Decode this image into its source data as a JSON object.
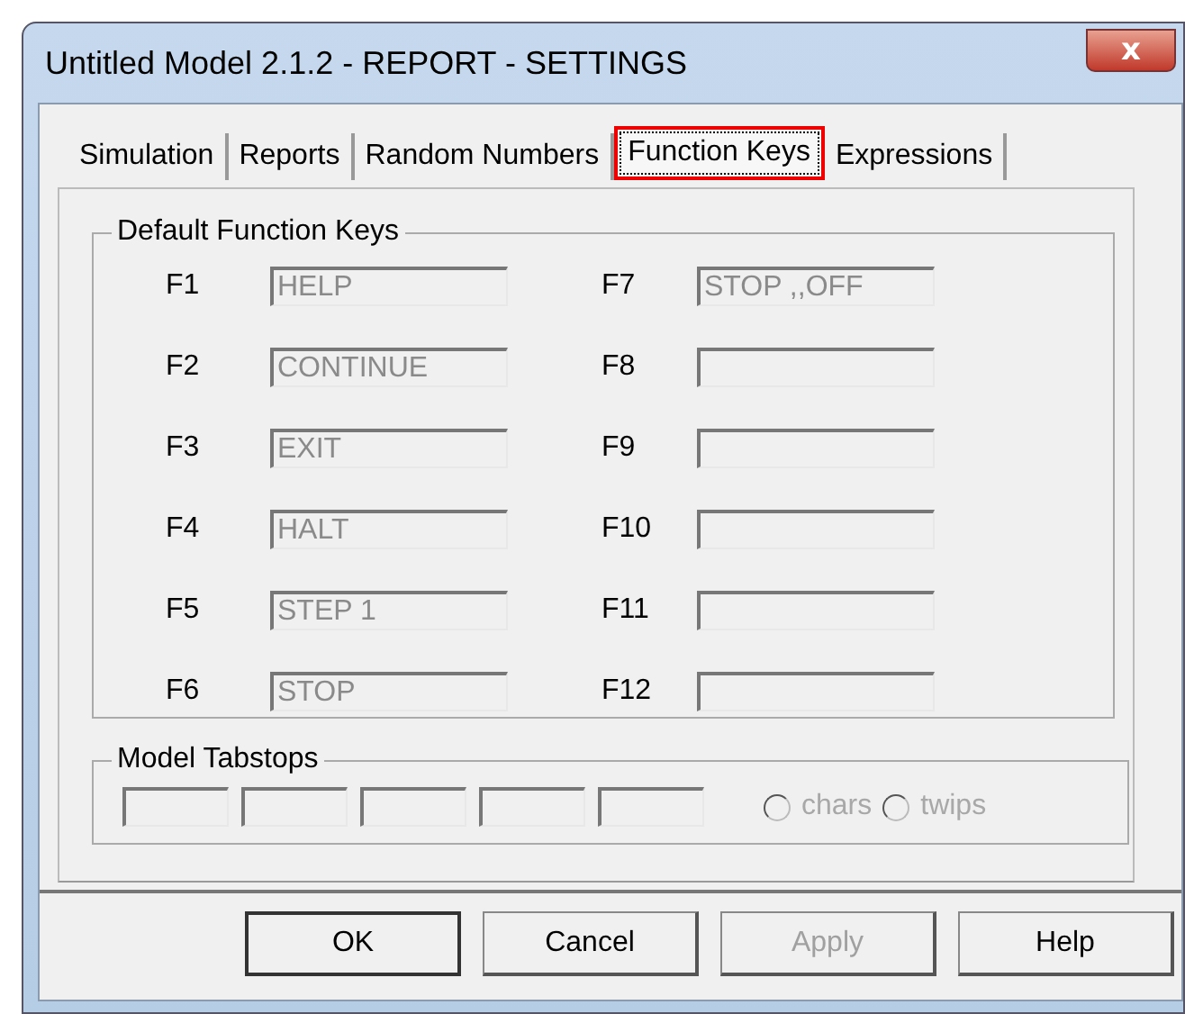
{
  "window": {
    "title": "Untitled Model 2.1.2  -  REPORT - SETTINGS",
    "close": "x"
  },
  "tabs": [
    {
      "label": "Simulation",
      "selected": false
    },
    {
      "label": "Reports",
      "selected": false
    },
    {
      "label": "Random Numbers",
      "selected": false
    },
    {
      "label": "Function Keys",
      "selected": true
    },
    {
      "label": "Expressions",
      "selected": false
    }
  ],
  "function_keys": {
    "title": "Default Function Keys",
    "keys": [
      {
        "key": "F1",
        "value": "HELP"
      },
      {
        "key": "F2",
        "value": "CONTINUE"
      },
      {
        "key": "F3",
        "value": "EXIT"
      },
      {
        "key": "F4",
        "value": "HALT"
      },
      {
        "key": "F5",
        "value": "STEP 1"
      },
      {
        "key": "F6",
        "value": "STOP"
      },
      {
        "key": "F7",
        "value": "STOP ,,OFF"
      },
      {
        "key": "F8"
      },
      {
        "key": "F9"
      },
      {
        "key": "F10"
      },
      {
        "key": "F11"
      },
      {
        "key": "F12"
      }
    ],
    "disabled": true
  },
  "tabstops": {
    "title": "Model Tabstops",
    "fields": [
      {
        "disabled": true
      },
      {
        "disabled": true
      },
      {
        "disabled": true
      },
      {
        "disabled": true
      },
      {
        "disabled": true
      }
    ],
    "disabled": true,
    "units": [
      {
        "label": "chars",
        "selected": false
      },
      {
        "label": "twips",
        "selected": false
      }
    ]
  },
  "buttons": [
    {
      "label": "OK",
      "default": true,
      "disabled": false
    },
    {
      "label": "Cancel",
      "default": false,
      "disabled": false
    },
    {
      "label": "Apply",
      "default": false,
      "disabled": true
    },
    {
      "label": "Help",
      "default": false,
      "disabled": false
    }
  ]
}
